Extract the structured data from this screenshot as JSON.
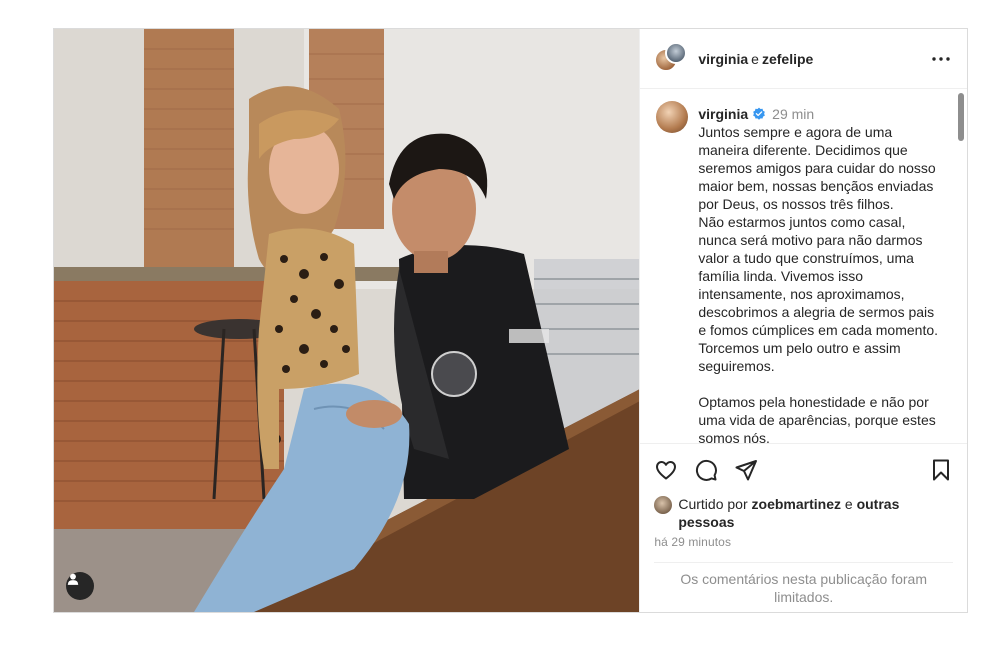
{
  "header": {
    "user1": "virginia",
    "conjunction": "e",
    "user2": "zefelipe",
    "more_icon": "more-horizontal-icon"
  },
  "caption": {
    "username": "virginia",
    "time": "29 min",
    "text": "Juntos sempre e agora de uma maneira diferente. Decidimos que seremos amigos para cuidar do nosso maior bem, nossas bençãos enviadas por Deus, os nossos três filhos.\nNão estarmos juntos como casal, nunca será motivo para não darmos valor a tudo que construímos, uma família linda. Vivemos isso intensamente, nos aproximamos, descobrimos a alegria de sermos pais e fomos cúmplices em cada momento. Torcemos um pelo outro e assim seguiremos.\n\nOptamos pela honestidade e não por uma vida de aparências, porque estes somos nós.\n\nNão julguem e não criem histórias"
  },
  "actions": {
    "like_icon": "heart-icon",
    "comment_icon": "comment-icon",
    "share_icon": "send-icon",
    "save_icon": "bookmark-icon"
  },
  "likes": {
    "prefix": "Curtido por",
    "user": "zoebmartinez",
    "conjunction": "e",
    "others": "outras pessoas"
  },
  "posted_ago": "há 29 minutos",
  "comments_notice": "Os comentários nesta publicação foram limitados.",
  "colors": {
    "verified_blue": "#3897f0",
    "border": "#dbdbdb",
    "muted_text": "#8e8e8e"
  }
}
